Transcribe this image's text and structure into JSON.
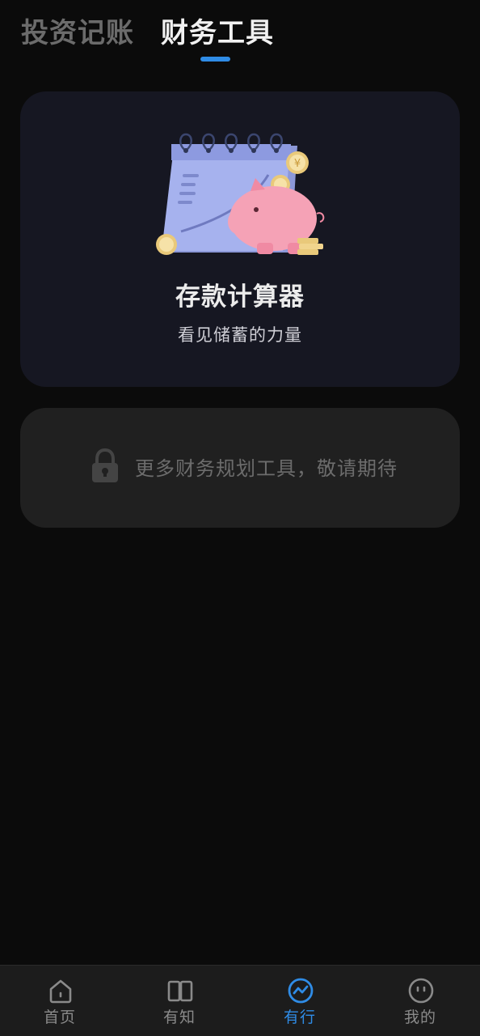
{
  "tabs": [
    {
      "label": "投资记账",
      "active": false
    },
    {
      "label": "财务工具",
      "active": true
    }
  ],
  "calculator_card": {
    "title": "存款计算器",
    "subtitle": "看见储蓄的力量",
    "illustration": "piggy-bank-calendar-illustration",
    "coin_symbol": "¥"
  },
  "more_tools_card": {
    "text": "更多财务规划工具，敬请期待",
    "icon": "lock-icon"
  },
  "bottom_nav": [
    {
      "label": "首页",
      "icon": "home-icon",
      "active": false
    },
    {
      "label": "有知",
      "icon": "book-icon",
      "active": false
    },
    {
      "label": "有行",
      "icon": "trend-icon",
      "active": true
    },
    {
      "label": "我的",
      "icon": "profile-face-icon",
      "active": false
    }
  ],
  "colors": {
    "accent": "#2f8ce6",
    "background": "#0b0b0b",
    "card": "#161722",
    "card_muted": "#202020"
  }
}
